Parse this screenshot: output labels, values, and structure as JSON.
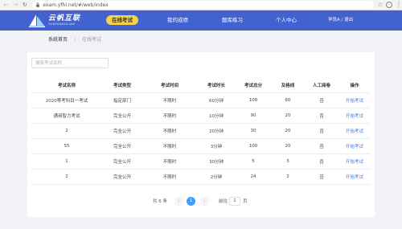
{
  "browser": {
    "url": "exam.yfhl.net/#/web/index"
  },
  "header": {
    "logo_cn": "云帆互联",
    "logo_en": "YUNFANHULIAN",
    "nav": [
      {
        "label": "在线考试",
        "active": true
      },
      {
        "label": "我的成绩",
        "active": false
      },
      {
        "label": "题库练习",
        "active": false
      },
      {
        "label": "个人中心",
        "active": false
      }
    ],
    "user": "学员A / 退出"
  },
  "breadcrumb": {
    "home": "系统首页",
    "separator": "/",
    "current": "在线考试"
  },
  "search": {
    "placeholder": "搜索考试名称"
  },
  "table": {
    "headers": [
      "考试名称",
      "考试类型",
      "考试时间",
      "考试时长",
      "考试总分",
      "及格线",
      "人工阅卷",
      "操作"
    ],
    "rows": [
      [
        "2020等考科目一考试",
        "指定部门",
        "不限时",
        "60分钟",
        "100",
        "60",
        "否",
        "开始考试"
      ],
      [
        "通用智力考试",
        "完全公开",
        "不限时",
        "10分钟",
        "90",
        "20",
        "否",
        "开始考试"
      ],
      [
        "2",
        "完全公开",
        "不限时",
        "20分钟",
        "30",
        "20",
        "否",
        "开始考试"
      ],
      [
        "55",
        "完全公开",
        "不限时",
        "3分钟",
        "100",
        "20",
        "否",
        "开始考试"
      ],
      [
        "1",
        "完全公开",
        "不限时",
        "30分钟",
        "5",
        "3",
        "否",
        "开始考试"
      ],
      [
        "2",
        "完全公开",
        "不限时",
        "2分钟",
        "24",
        "2",
        "否",
        "开始考试"
      ]
    ]
  },
  "pagination": {
    "total": "共 6 条",
    "prev": "‹",
    "page": "1",
    "next": "›",
    "goto_label": "前往",
    "goto_value": "1",
    "page_suffix": "页"
  },
  "colors": {
    "header_bg": "#4262d0",
    "active_tab": "#f6d24a",
    "link": "#4a7fe0",
    "page_active": "#409eff"
  }
}
